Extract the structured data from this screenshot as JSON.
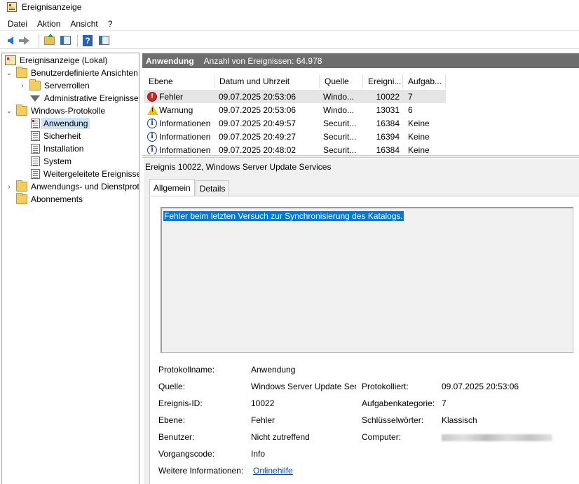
{
  "window": {
    "title": "Ereignisanzeige"
  },
  "menu": [
    "Datei",
    "Aktion",
    "Ansicht",
    "?"
  ],
  "tree": [
    {
      "label": "Ereignisanzeige (Lokal)",
      "icon": "event-viewer-icon",
      "toggle": "",
      "indent": 0
    },
    {
      "label": "Benutzerdefinierte Ansichten",
      "icon": "folder-icon",
      "toggle": "expanded",
      "indent": 1
    },
    {
      "label": "Serverrollen",
      "icon": "folder-icon",
      "toggle": "collapsed",
      "indent": 2
    },
    {
      "label": "Administrative Ereignisse",
      "icon": "filter-icon",
      "toggle": "",
      "indent": 2
    },
    {
      "label": "Windows-Protokolle",
      "icon": "folder-icon",
      "toggle": "expanded",
      "indent": 1
    },
    {
      "label": "Anwendung",
      "icon": "log-icon",
      "toggle": "",
      "indent": 2,
      "selected": true
    },
    {
      "label": "Sicherheit",
      "icon": "log-icon",
      "toggle": "",
      "indent": 2
    },
    {
      "label": "Installation",
      "icon": "log-icon",
      "toggle": "",
      "indent": 2
    },
    {
      "label": "System",
      "icon": "log-icon",
      "toggle": "",
      "indent": 2
    },
    {
      "label": "Weitergeleitete Ereignisse",
      "icon": "log-icon",
      "toggle": "",
      "indent": 2
    },
    {
      "label": "Anwendungs- und Dienstprotokolle",
      "icon": "folder-icon",
      "toggle": "collapsed",
      "indent": 1
    },
    {
      "label": "Abonnements",
      "icon": "folder-icon",
      "toggle": "",
      "indent": 1
    }
  ],
  "header": {
    "name": "Anwendung",
    "count": "Anzahl von Ereignissen: 64.978"
  },
  "events": {
    "columns": [
      "Ebene",
      "Datum und Uhrzeit",
      "Quelle",
      "Ereigni...",
      "Aufgab..."
    ],
    "rows": [
      {
        "level": "Fehler",
        "level_type": "error",
        "date": "09.07.2025 20:53:06",
        "source": "Windo...",
        "id": "10022",
        "task": "7",
        "selected": true
      },
      {
        "level": "Warnung",
        "level_type": "warning",
        "date": "09.07.2025 20:53:06",
        "source": "Windo...",
        "id": "13031",
        "task": "6"
      },
      {
        "level": "Informationen",
        "level_type": "info",
        "date": "09.07.2025 20:49:57",
        "source": "Securit...",
        "id": "16384",
        "task": "Keine"
      },
      {
        "level": "Informationen",
        "level_type": "info",
        "date": "09.07.2025 20:49:27",
        "source": "Securit...",
        "id": "16394",
        "task": "Keine"
      },
      {
        "level": "Informationen",
        "level_type": "info",
        "date": "09.07.2025 20:48:02",
        "source": "Securit...",
        "id": "16384",
        "task": "Keine"
      }
    ]
  },
  "detail": {
    "title": "Ereignis 10022, Windows Server Update Services",
    "tabs": [
      "Allgemein",
      "Details"
    ],
    "description": "Fehler beim letzten Versuch zur Synchronisierung des Katalogs.",
    "props": {
      "protokollname_label": "Protokollname:",
      "protokollname": "Anwendung",
      "quelle_label": "Quelle:",
      "quelle": "Windows Server Update Services",
      "protokolliert_label": "Protokolliert:",
      "protokolliert": "09.07.2025 20:53:06",
      "ereignis_id_label": "Ereignis-ID:",
      "ereignis_id": "10022",
      "aufgabenkategorie_label": "Aufgabenkategorie:",
      "aufgabenkategorie": "7",
      "ebene_label": "Ebene:",
      "ebene": "Fehler",
      "schluesselwoerter_label": "Schlüsselwörter:",
      "schluesselwoerter": "Klassisch",
      "benutzer_label": "Benutzer:",
      "benutzer": "Nicht zutreffend",
      "computer_label": "Computer:",
      "vorgangscode_label": "Vorgangscode:",
      "vorgangscode": "Info",
      "weitere_label": "Weitere Informationen:",
      "weitere_link": "Onlinehilfe"
    }
  }
}
